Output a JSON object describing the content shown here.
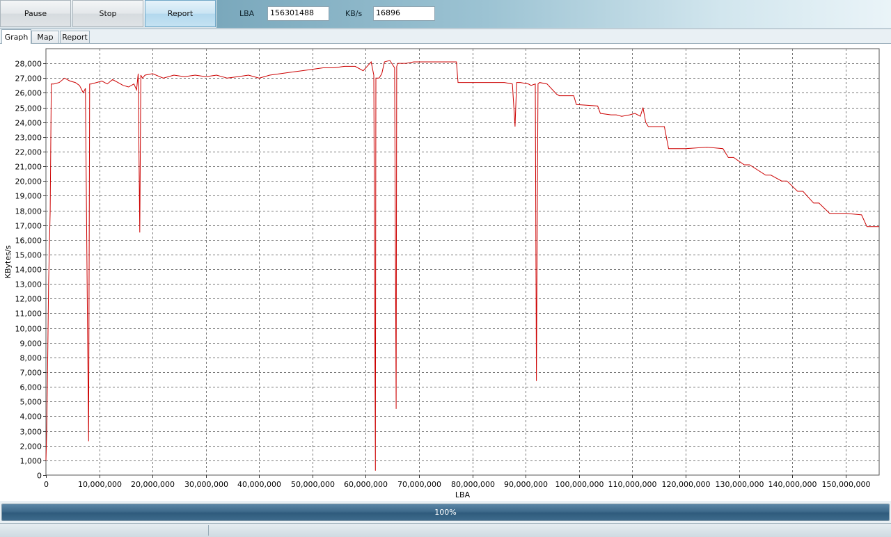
{
  "toolbar": {
    "pause_label": "Pause",
    "stop_label": "Stop",
    "report_label": "Report",
    "lba_label": "LBA",
    "lba_value": "156301488",
    "kbs_label": "KB/s",
    "kbs_value": "16896"
  },
  "tabs": [
    {
      "label": "Graph",
      "selected": true
    },
    {
      "label": "Map",
      "selected": false
    },
    {
      "label": "Report",
      "selected": false
    }
  ],
  "chart_data": {
    "type": "line",
    "xlabel": "LBA",
    "ylabel": "KBytes/s",
    "xlim": [
      0,
      156301488
    ],
    "ylim": [
      0,
      29000
    ],
    "x_ticks": [
      0,
      10000000,
      20000000,
      30000000,
      40000000,
      50000000,
      60000000,
      70000000,
      80000000,
      90000000,
      100000000,
      110000000,
      120000000,
      130000000,
      140000000,
      150000000
    ],
    "x_tick_labels": [
      "0",
      "10,000,000",
      "20,000,000",
      "30,000,000",
      "40,000,000",
      "50,000,000",
      "60,000,000",
      "70,000,000",
      "80,000,000",
      "90,000,000",
      "100,000,000",
      "110,000,000",
      "120,000,000",
      "130,000,000",
      "140,000,000",
      "150,000,000"
    ],
    "y_ticks": [
      0,
      1000,
      2000,
      3000,
      4000,
      5000,
      6000,
      7000,
      8000,
      9000,
      10000,
      11000,
      12000,
      13000,
      14000,
      15000,
      16000,
      17000,
      18000,
      19000,
      20000,
      21000,
      22000,
      23000,
      24000,
      25000,
      26000,
      27000,
      28000
    ],
    "y_tick_labels": [
      "0",
      "1,000",
      "2,000",
      "3,000",
      "4,000",
      "5,000",
      "6,000",
      "7,000",
      "8,000",
      "9,000",
      "10,000",
      "11,000",
      "12,000",
      "13,000",
      "14,000",
      "15,000",
      "16,000",
      "17,000",
      "18,000",
      "19,000",
      "20,000",
      "21,000",
      "22,000",
      "23,000",
      "24,000",
      "25,000",
      "26,000",
      "27,000",
      "28,000"
    ],
    "grid": true,
    "line_color": "#cc0000",
    "series": [
      {
        "x": [
          0,
          150000,
          300000,
          500000,
          800000,
          1000000,
          1500000,
          2500000,
          3500000,
          4500000,
          5500000,
          6300000,
          7000000,
          7400000,
          7700000,
          7900000,
          8000000,
          8200000,
          8500000,
          9500000,
          10500000,
          11500000,
          12500000,
          13500000,
          14500000,
          15500000,
          16500000,
          17000000,
          17300000,
          17600000,
          17800000,
          18100000,
          18600000,
          20000000,
          22000000,
          24000000,
          26000000,
          28000000,
          30000000,
          32000000,
          34000000,
          36000000,
          38000000,
          40000000,
          42000000,
          44000000,
          46000000,
          48000000,
          50000000,
          52000000,
          54000000,
          56000000,
          58000000,
          59500000,
          60500000,
          61000000,
          61500000,
          61800000,
          61900000,
          62500000,
          63000000,
          63500000,
          64500000,
          65400000,
          65700000,
          65800000,
          66000000,
          66500000,
          67500000,
          69000000,
          71000000,
          73000000,
          75000000,
          77000000,
          77300000,
          78000000,
          80000000,
          83000000,
          86000000,
          87500000,
          88000000,
          88300000,
          89000000,
          90500000,
          91000000,
          91800000,
          92000000,
          92300000,
          92600000,
          94000000,
          95800000,
          96300000,
          99000000,
          99500000,
          103500000,
          104000000,
          106000000,
          107000000,
          108000000,
          109500000,
          110500000,
          111500000,
          112000000,
          112500000,
          113000000,
          116000000,
          116800000,
          120000000,
          124000000,
          127000000,
          128000000,
          129000000,
          131000000,
          132000000,
          135000000,
          136000000,
          138000000,
          139000000,
          141000000,
          142000000,
          144000000,
          145000000,
          147000000,
          148000000,
          150000000,
          153000000,
          154000000,
          156301488
        ],
        "y": [
          1000,
          3000,
          7000,
          13000,
          18000,
          26600,
          26600,
          26700,
          27000,
          26800,
          26700,
          26500,
          26000,
          26300,
          14000,
          6200,
          2300,
          26600,
          26600,
          26700,
          26800,
          26600,
          26900,
          26700,
          26500,
          26400,
          26600,
          26200,
          27300,
          16500,
          27200,
          27000,
          27200,
          27300,
          27000,
          27200,
          27100,
          27200,
          27100,
          27200,
          27000,
          27100,
          27200,
          27000,
          27200,
          27300,
          27400,
          27500,
          27600,
          27700,
          27700,
          27800,
          27800,
          27500,
          27900,
          28100,
          27200,
          300,
          27000,
          27000,
          27300,
          28100,
          28200,
          27700,
          4500,
          27800,
          28000,
          28000,
          28000,
          28100,
          28100,
          28100,
          28100,
          28100,
          26700,
          26700,
          26700,
          26700,
          26700,
          26600,
          23700,
          26700,
          26700,
          26600,
          26500,
          26600,
          6400,
          26600,
          26700,
          26600,
          25900,
          25800,
          25800,
          25200,
          25100,
          24600,
          24500,
          24500,
          24400,
          24500,
          24600,
          24400,
          25000,
          24000,
          23700,
          23700,
          22200,
          22200,
          22300,
          22200,
          21600,
          21600,
          21100,
          21100,
          20400,
          20400,
          20000,
          20000,
          19300,
          19300,
          18500,
          18500,
          17800,
          17800,
          17800,
          17700,
          16900,
          16900
        ]
      }
    ]
  },
  "progress": {
    "value": 1.0,
    "text": "100%"
  }
}
